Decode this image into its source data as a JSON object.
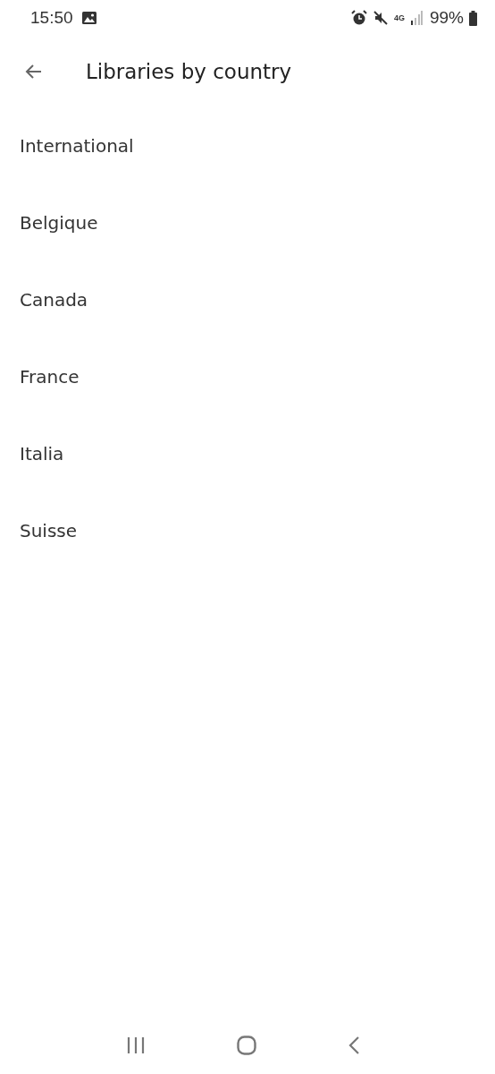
{
  "status_bar": {
    "time": "15:50",
    "network": "4G",
    "battery": "99%"
  },
  "toolbar": {
    "title": "Libraries by country"
  },
  "countries": [
    {
      "label": "International"
    },
    {
      "label": "Belgique"
    },
    {
      "label": "Canada"
    },
    {
      "label": "France"
    },
    {
      "label": "Italia"
    },
    {
      "label": "Suisse"
    }
  ]
}
